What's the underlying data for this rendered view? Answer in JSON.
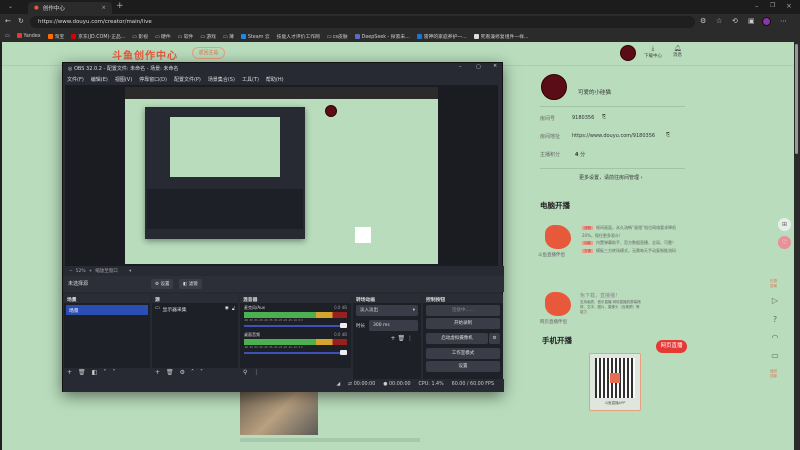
{
  "browser": {
    "tab_title": "创作中心",
    "url": "https://www.douyu.com/creator/main/live",
    "bookmarks": [
      "Yandex",
      "淘宝",
      "京东(JD.COM)-正品...",
      "影视",
      "硬件",
      "软件",
      "游戏",
      "薄",
      "Steam 云",
      "技能人才评价工作网",
      "cs皮肤",
      "DeepSeek - 探索未...",
      "雷神的家庭养护一...",
      "死看兼修复组件一样..."
    ]
  },
  "site": {
    "logo": "斗鱼创作中心",
    "logo_sub": "DOUYU CREATOR CENTER",
    "back_button": "返回主站",
    "download_center": "下载中心",
    "messages": "消息"
  },
  "profile": {
    "name": "可爱的小硅猫",
    "room_id_label": "房间号",
    "room_id": "9180356",
    "room_url_label": "房间地址",
    "room_url": "https://www.douyu.com/9180356",
    "score_label": "主播积分",
    "score": "4",
    "score_unit": "分",
    "more_settings": "更多设置，请前往房间管理 ›"
  },
  "pc_live": {
    "title": "电脑开播",
    "tool_name": "斗鱼直播伴侣",
    "features": [
      {
        "tag": "流畅",
        "text": "帧间画面，永久流畅“极限”档位网络要求降低20%，保住更多观众！"
      },
      {
        "tag": "功能",
        "text": "内置弹幕助手、官方数据直播、全局、可靠！"
      },
      {
        "tag": "方便",
        "text": "模板三方转场模式，无需每天手动复制推流码"
      }
    ],
    "web_title": "免下载，直接播！",
    "web_desc": "支持画质、音乐直播 网络直播的屏幕捕获、文字、图片、摄像头（含美颜）等能力",
    "web_tool_name": "网页直播伴侣",
    "web_button": "网页直播"
  },
  "mobile_live": {
    "title": "手机开播",
    "qr_caption": "斗鱼直播APP"
  },
  "right_rail": {
    "top_label": "礼物答案",
    "bottom_label": "返回顶部"
  },
  "obs": {
    "title": "OBS 32.0.2 - 配置文件: 未命名 - 场景: 未命名",
    "menu": [
      "文件(F)",
      "编辑(E)",
      "视图(V)",
      "停靠窗口(D)",
      "配置文件(P)",
      "场景集合(S)",
      "工具(T)",
      "帮助(H)"
    ],
    "zoom": "52%",
    "zoom_mode": "缩放至窗口",
    "no_source": "未选择源",
    "properties_button": "设置",
    "filters_button": "滤镜",
    "docks": {
      "scenes": {
        "title": "场景",
        "items": [
          "场景"
        ]
      },
      "sources": {
        "title": "源",
        "items": [
          "显示器采集"
        ]
      },
      "mixer": {
        "title": "混音器",
        "channels": [
          {
            "name": "麦克风/Aux",
            "db": "0.0 dB"
          },
          {
            "name": "桌面音频",
            "db": "0.0 dB"
          }
        ],
        "scale": "-60 -55 -50 -45 -40 -35 -30 -25 -20 -15 -10 -5 0"
      },
      "transitions": {
        "title": "转场动画",
        "type": "淡入淡出",
        "duration_label": "时长",
        "duration": "300 ms"
      },
      "controls": {
        "title": "控制按钮",
        "buttons": [
          "连接中......",
          "开始录制",
          "启动虚拟摄像机",
          "工作室模式",
          "设置"
        ]
      }
    },
    "status": {
      "stream_time": "00:00:00",
      "rec_time": "00:00:00",
      "cpu": "CPU: 1.4%",
      "fps": "60.00 / 60.00 FPS"
    }
  }
}
